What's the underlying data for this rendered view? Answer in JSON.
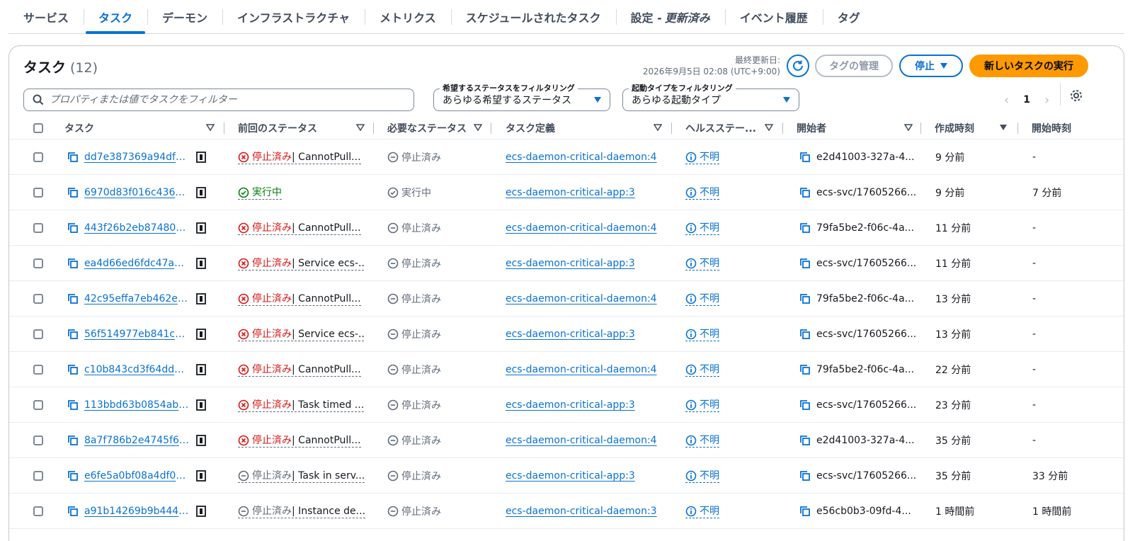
{
  "tabs": [
    {
      "label": "サービス",
      "active": false
    },
    {
      "label": "タスク",
      "active": true
    },
    {
      "label": "デーモン",
      "active": false
    },
    {
      "label": "インフラストラクチャ",
      "active": false
    },
    {
      "label": "メトリクス",
      "active": false
    },
    {
      "label": "スケジュールされたタスク",
      "active": false
    },
    {
      "label": "設定 -",
      "suffix": "更新済み",
      "active": false
    },
    {
      "label": "イベント履歴",
      "active": false
    },
    {
      "label": "タグ",
      "active": false
    }
  ],
  "header": {
    "title": "タスク",
    "count": "(12)",
    "last_updated_label": "最終更新日:",
    "last_updated_value": "2026年9月5日 02:08 (UTC+9:00)",
    "manage_tags_label": "タグの管理",
    "stop_label": "停止",
    "run_new_task_label": "新しいタスクの実行"
  },
  "filters": {
    "search_placeholder": "プロパティまたは値でタスクをフィルター",
    "desired_status_label": "希望するステータスをフィルタリング",
    "desired_status_value": "あらゆる希望するステータス",
    "launch_type_label": "起動タイプをフィルタリング",
    "launch_type_value": "あらゆる起動タイプ"
  },
  "pagination": {
    "current_page": "1"
  },
  "columns": [
    "タスク",
    "前回のステータス",
    "必要なステータス",
    "タスク定義",
    "ヘルスステー...",
    "開始者",
    "作成時刻",
    "開始時刻"
  ],
  "rows": [
    {
      "task": "dd7e387369a94df09...",
      "last_status": "停止済み",
      "last_detail": " | CannotPull...",
      "last_kind": "error",
      "desired": "停止済み",
      "desired_kind": "stopped",
      "taskdef": "ecs-daemon-critical-daemon:4",
      "health": "不明",
      "started_by": "e2d41003-327a-4...",
      "created": "9 分前",
      "started": "-"
    },
    {
      "task": "6970d83f016c436da...",
      "last_status": "実行中",
      "last_detail": "",
      "last_kind": "running",
      "desired": "実行中",
      "desired_kind": "running",
      "taskdef": "ecs-daemon-critical-app:3",
      "health": "不明",
      "started_by": "ecs-svc/17605266...",
      "created": "9 分前",
      "started": "7 分前"
    },
    {
      "task": "443f26b2eb8748079...",
      "last_status": "停止済み",
      "last_detail": " | CannotPull...",
      "last_kind": "error",
      "desired": "停止済み",
      "desired_kind": "stopped",
      "taskdef": "ecs-daemon-critical-daemon:4",
      "health": "不明",
      "started_by": "79fa5be2-f06c-4a...",
      "created": "11 分前",
      "started": "-"
    },
    {
      "task": "ea4d66ed6fdc47a98...",
      "last_status": "停止済み",
      "last_detail": " | Service ecs-...",
      "last_kind": "error",
      "desired": "停止済み",
      "desired_kind": "stopped",
      "taskdef": "ecs-daemon-critical-app:3",
      "health": "不明",
      "started_by": "ecs-svc/17605266...",
      "created": "11 分前",
      "started": "-"
    },
    {
      "task": "42c95effa7eb462ea7...",
      "last_status": "停止済み",
      "last_detail": " | CannotPull...",
      "last_kind": "error",
      "desired": "停止済み",
      "desired_kind": "stopped",
      "taskdef": "ecs-daemon-critical-daemon:4",
      "health": "不明",
      "started_by": "79fa5be2-f06c-4a...",
      "created": "13 分前",
      "started": "-"
    },
    {
      "task": "56f514977eb841c3a...",
      "last_status": "停止済み",
      "last_detail": " | Service ecs-...",
      "last_kind": "error",
      "desired": "停止済み",
      "desired_kind": "stopped",
      "taskdef": "ecs-daemon-critical-app:3",
      "health": "不明",
      "started_by": "ecs-svc/17605266...",
      "created": "13 分前",
      "started": "-"
    },
    {
      "task": "c10b843cd3f64dd28...",
      "last_status": "停止済み",
      "last_detail": " | CannotPull...",
      "last_kind": "error",
      "desired": "停止済み",
      "desired_kind": "stopped",
      "taskdef": "ecs-daemon-critical-daemon:4",
      "health": "不明",
      "started_by": "79fa5be2-f06c-4a...",
      "created": "22 分前",
      "started": "-"
    },
    {
      "task": "113bbd63b0854abb...",
      "last_status": "停止済み",
      "last_detail": " | Task timed ...",
      "last_kind": "error",
      "desired": "停止済み",
      "desired_kind": "stopped",
      "taskdef": "ecs-daemon-critical-app:3",
      "health": "不明",
      "started_by": "ecs-svc/17605266...",
      "created": "23 分前",
      "started": "-"
    },
    {
      "task": "8a7f786b2e4745f69...",
      "last_status": "停止済み",
      "last_detail": " | CannotPull...",
      "last_kind": "error",
      "desired": "停止済み",
      "desired_kind": "stopped",
      "taskdef": "ecs-daemon-critical-daemon:4",
      "health": "不明",
      "started_by": "e2d41003-327a-4...",
      "created": "35 分前",
      "started": "-"
    },
    {
      "task": "e6fe5a0bf08a4df0b4...",
      "last_status": "停止済み",
      "last_detail": " | Task in serv...",
      "last_kind": "stopped",
      "desired": "停止済み",
      "desired_kind": "stopped",
      "taskdef": "ecs-daemon-critical-app:3",
      "health": "不明",
      "started_by": "ecs-svc/17605266...",
      "created": "35 分前",
      "started": "33 分前"
    },
    {
      "task": "a91b14269b9b444f8...",
      "last_status": "停止済み",
      "last_detail": " | Instance de...",
      "last_kind": "stopped",
      "desired": "停止済み",
      "desired_kind": "stopped",
      "taskdef": "ecs-daemon-critical-daemon:3",
      "health": "不明",
      "started_by": "e56cb0b3-09fd-4...",
      "created": "1 時間前",
      "started": "1 時間前"
    }
  ],
  "colors": {
    "accent": "#0972d3",
    "primary_button": "#ff9900",
    "error": "#d91515",
    "success": "#037f0c",
    "muted": "#5f6b7a"
  }
}
